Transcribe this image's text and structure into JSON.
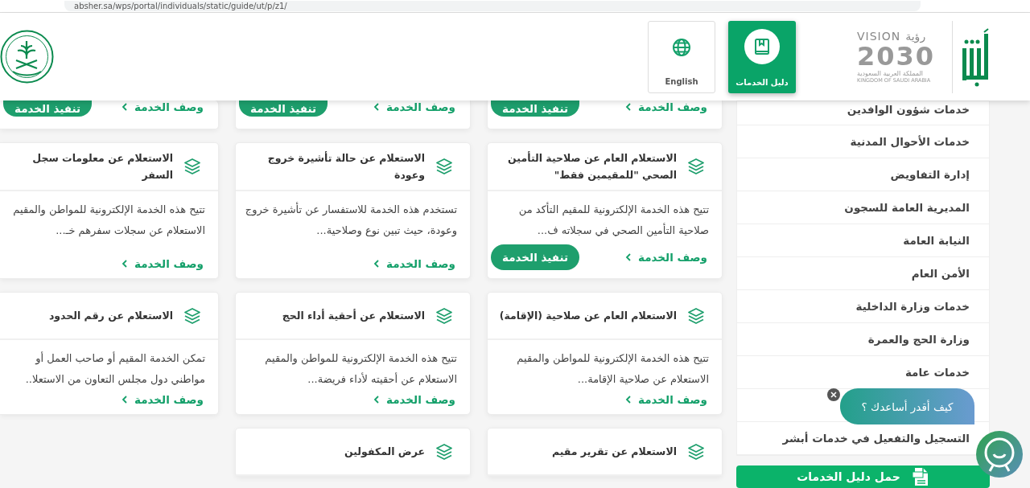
{
  "browser": {
    "url": "absher.sa/wps/portal/individuals/static/guide/ut/p/z1/"
  },
  "header": {
    "vision_logo": {
      "vision": "VISION",
      "ruya": "رؤية",
      "year": "2030",
      "kingdom_ar": "المملكة العربية السعودية",
      "kingdom_en": "KINGDOM OF SAUDI ARABIA"
    },
    "nav_buttons": [
      {
        "label": "دليل الخدمات",
        "kind": "guide",
        "selected": true
      },
      {
        "label": "English",
        "kind": "language",
        "selected": false
      }
    ]
  },
  "card_rows": [
    {
      "cards": [
        {
          "link": "وصف الخدمة",
          "action": "تنفيذ الخدمة"
        },
        {
          "link": "وصف الخدمة",
          "action": "تنفيذ الخدمة"
        },
        {
          "link": "وصف الخدمة",
          "action": "تنفيذ الخدمة"
        }
      ]
    },
    {
      "cards": [
        {
          "title": "الاستعلام العام عن صلاحية التأمين الصحي \"للمقيمين فقط\"",
          "description": "تتيح هذه الخدمة الإلكترونية للمقيم التأكد من صلاحية التأمين الصحي في سجلاته ف...",
          "link": "وصف الخدمة",
          "action": "تنفيذ الخدمة"
        },
        {
          "title": "الاستعلام عن حالة تأشيرة خروج وعودة",
          "description": "تستخدم هذه الخدمة للاستفسار عن تأشيرة خروج وعودة، حيث تبين نوع وصلاحية...",
          "link": "وصف الخدمة"
        },
        {
          "title": "الاستعلام عن معلومات سجل السفر",
          "description": "تتيح هذه الخدمة الإلكترونية للمواطن والمقيم الاستعلام عن سجلات سفرهم خـ...",
          "link": "وصف الخدمة"
        }
      ]
    },
    {
      "cards": [
        {
          "title": "الاستعلام العام عن صلاحية (الإقامة)",
          "description": "تتيح هذه الخدمة الإلكترونية للمواطن والمقيم الاستعلام عن صلاحية الإقامة...",
          "link": "وصف الخدمة"
        },
        {
          "title": "الاستعلام عن أحقية أداء الحج",
          "description": "تتيح هذه الخدمة الإلكترونية للمواطن والمقيم الاستعلام عن أحقيته لأداء فريضة...",
          "link": "وصف الخدمة"
        },
        {
          "title": "الاستعلام عن رقم الحدود",
          "description": "تمكن الخدمة المقيم أو صاحب العمل أو مواطني دول مجلس التعاون من الاستعلا..",
          "link": "وصف الخدمة"
        }
      ]
    },
    {
      "cards": [
        {
          "title": "الاستعلام عن تقرير مقيم"
        },
        {
          "title": "عرض المكفولين"
        }
      ]
    }
  ],
  "sidebar": {
    "items": [
      {
        "label": "خدمات شؤون الوافدين"
      },
      {
        "label": "خدمات الأحوال المدنية"
      },
      {
        "label": "إدارة التفاويض"
      },
      {
        "label": "المديرية العامة للسجون"
      },
      {
        "label": "النيابة العامة"
      },
      {
        "label": "الأمن العام"
      },
      {
        "label": "خدمات وزارة الداخلية"
      },
      {
        "label": "وزارة الحج والعمرة"
      },
      {
        "label": "خدمات عامة"
      },
      {
        "covered": true
      },
      {
        "label": "التسجيل والتفعيل في خدمات أبشر"
      }
    ],
    "download_button": "حمل دليل الخدمات"
  },
  "chat": {
    "prompt": "كيف أقدر أساعدك ؟"
  }
}
